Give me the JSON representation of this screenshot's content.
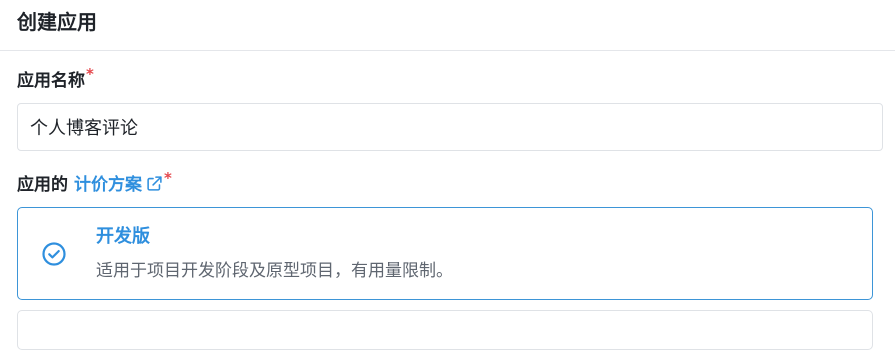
{
  "header": {
    "title": "创建应用"
  },
  "form": {
    "name_label": "应用名称",
    "required_mark": "*",
    "name_value": "个人博客评论",
    "plan_label_prefix": "应用的",
    "plan_link_label": "计价方案"
  },
  "plans": [
    {
      "title": "开发版",
      "description": "适用于项目开发阶段及原型项目，有用量限制。",
      "selected": true
    }
  ],
  "colors": {
    "accent": "#2f8fde",
    "required": "#e5484d",
    "selected_border": "#3d95d7"
  },
  "icons": {
    "plan_link": "external-link-icon",
    "selected_plan": "check-circle-icon"
  }
}
